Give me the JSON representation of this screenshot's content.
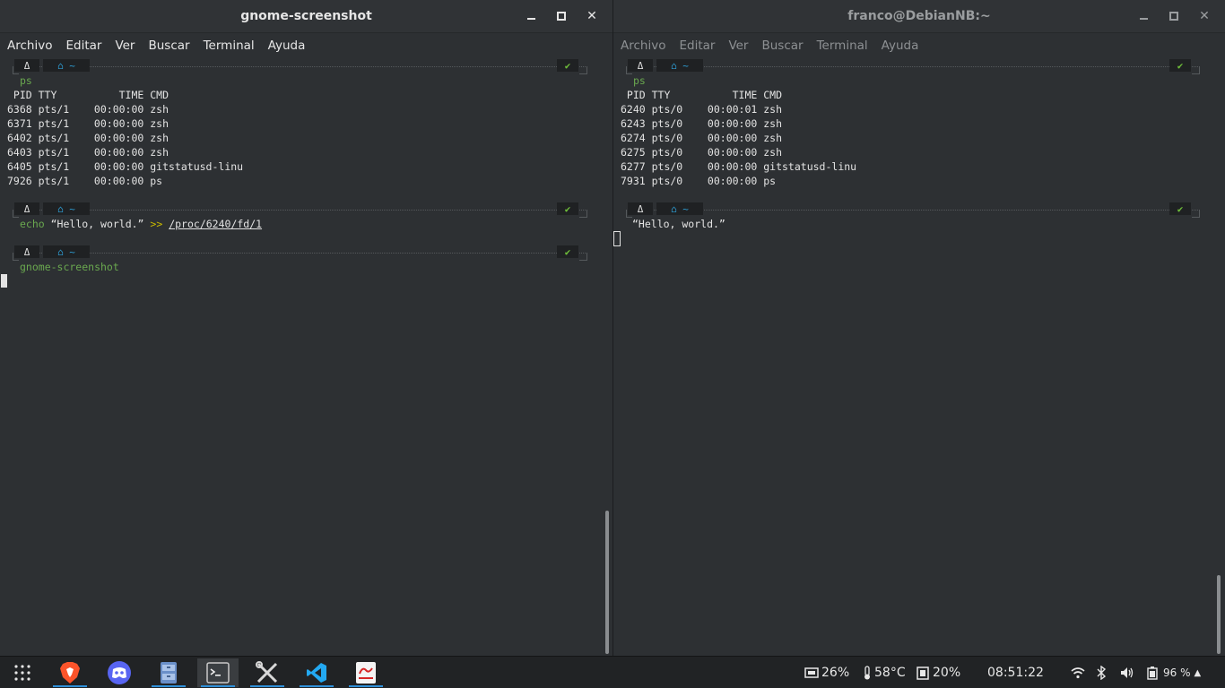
{
  "left_window": {
    "title": "gnome-screenshot",
    "menu": [
      "Archivo",
      "Editar",
      "Ver",
      "Buscar",
      "Terminal",
      "Ayuda"
    ],
    "prompt_os": "Δ",
    "prompt_home": "⌂  ~",
    "prompt_ok": "✔",
    "cmd1": "ps",
    "ps_header": " PID TTY          TIME CMD",
    "ps_rows": [
      "6368 pts/1    00:00:00 zsh",
      "6371 pts/1    00:00:00 zsh",
      "6402 pts/1    00:00:00 zsh",
      "6403 pts/1    00:00:00 zsh",
      "6405 pts/1    00:00:00 gitstatusd-linu",
      "7926 pts/1    00:00:00 ps"
    ],
    "cmd2_echo": "echo",
    "cmd2_arg": " “Hello, world.” ",
    "cmd2_redir": ">>",
    "cmd2_path": "/proc/6240/fd/1",
    "cmd3": "gnome-screenshot"
  },
  "right_window": {
    "title": "franco@DebianNB:~",
    "menu": [
      "Archivo",
      "Editar",
      "Ver",
      "Buscar",
      "Terminal",
      "Ayuda"
    ],
    "cmd1": "ps",
    "ps_header": " PID TTY          TIME CMD",
    "ps_rows": [
      "6240 pts/0    00:00:01 zsh",
      "6243 pts/0    00:00:00 zsh",
      "6274 pts/0    00:00:00 zsh",
      "6275 pts/0    00:00:00 zsh",
      "6277 pts/0    00:00:00 gitstatusd-linu",
      "7931 pts/0    00:00:00 ps"
    ],
    "output": "“Hello, world.”"
  },
  "taskbar": {
    "apps": [
      "app-grid-icon",
      "brave-icon",
      "discord-icon",
      "files-icon",
      "terminal-icon",
      "tools-icon",
      "vscode-icon",
      "editor-icon"
    ],
    "cpu": "26%",
    "temp": "58°C",
    "mem": "20%",
    "clock": "08:51:22",
    "battery": "96 %"
  },
  "colors": {
    "accent": "#2e8fd8",
    "prompt_green": "#6aa84f",
    "redir_yellow": "#c8b800"
  }
}
